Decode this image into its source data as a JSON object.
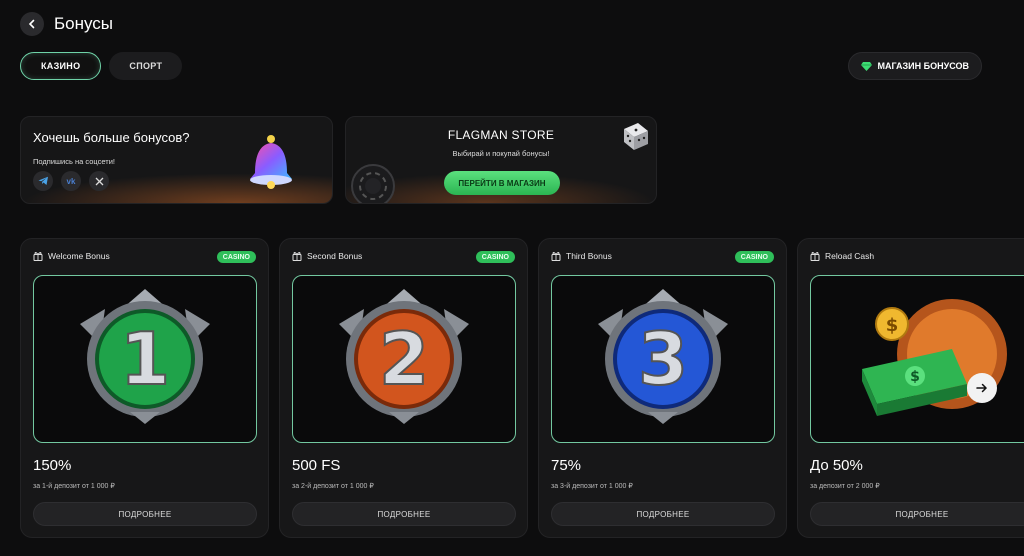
{
  "header": {
    "title": "Бонусы"
  },
  "tabs": [
    {
      "label": "КАЗИНО",
      "active": true
    },
    {
      "label": "СПОРТ",
      "active": false
    }
  ],
  "store_button": {
    "label": "МАГАЗИН БОНУСОВ"
  },
  "promo_social": {
    "title": "Хочешь больше бонусов?",
    "subtitle": "Подпишись на соцсети!",
    "icons": [
      "telegram-icon",
      "vk-icon",
      "x-icon"
    ]
  },
  "promo_store": {
    "title": "FLAGMAN STORE",
    "subtitle": "Выбирай и покупай бонусы!",
    "cta": "ПЕРЕЙТИ В МАГАЗИН"
  },
  "cards": [
    {
      "name": "Welcome Bonus",
      "badge": "CASINO",
      "amount": "150%",
      "condition": "за 1-й депозит от 1 000 ₽",
      "button": "ПОДРОБНЕЕ",
      "medal_number": "1",
      "medal_color": "#1fa34a"
    },
    {
      "name": "Second Bonus",
      "badge": "CASINO",
      "amount": "500 FS",
      "condition": "за 2-й депозит от 1 000 ₽",
      "button": "ПОДРОБНЕЕ",
      "medal_number": "2",
      "medal_color": "#d2551e"
    },
    {
      "name": "Third Bonus",
      "badge": "CASINO",
      "amount": "75%",
      "condition": "за 3-й депозит от 1 000 ₽",
      "button": "ПОДРОБНЕЕ",
      "medal_number": "3",
      "medal_color": "#2457d6"
    },
    {
      "name": "Reload Cash",
      "badge": "",
      "amount": "До 50%",
      "condition": "за депозит от 2 000 ₽",
      "button": "ПОДРОБНЕЕ",
      "medal_number": "",
      "medal_color": "#3bbf5a"
    }
  ],
  "colors": {
    "accent_green": "#2fbf5a",
    "card_border_glow": "#73c8a0",
    "background": "#0d0d0e"
  }
}
